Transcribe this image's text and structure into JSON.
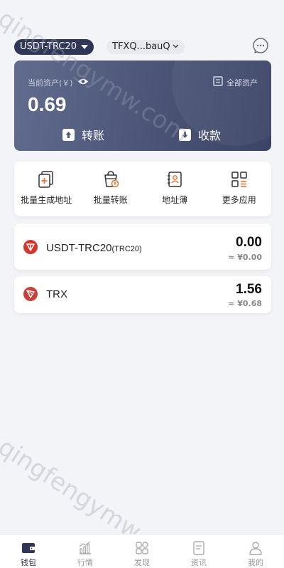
{
  "header": {
    "chain_label": "USDT-TRC20",
    "address_label": "TFXQ...bauQ"
  },
  "asset_card": {
    "asset_label": "当前资产(￥)",
    "all_assets_label": "全部资产",
    "balance": "0.69",
    "transfer_label": "转账",
    "receive_label": "收款"
  },
  "quick_actions": [
    {
      "label": "批量生成地址",
      "icon": "batch-address-icon"
    },
    {
      "label": "批量转账",
      "icon": "batch-transfer-icon"
    },
    {
      "label": "地址薄",
      "icon": "address-book-icon"
    },
    {
      "label": "更多应用",
      "icon": "more-apps-icon"
    }
  ],
  "tokens": [
    {
      "name": "USDT-TRC20",
      "suffix": "(TRC20)",
      "amount": "0.00",
      "fiat": "≈ ¥0.00",
      "icon": "tron-token-icon"
    },
    {
      "name": "TRX",
      "suffix": "",
      "amount": "1.56",
      "fiat": "≈ ¥0.68",
      "icon": "trx-icon"
    }
  ],
  "watermark": "qingfengymw.com",
  "tabbar": [
    {
      "label": "钱包",
      "icon": "wallet-icon",
      "active": true
    },
    {
      "label": "行情",
      "icon": "chart-icon",
      "active": false
    },
    {
      "label": "发现",
      "icon": "discover-icon",
      "active": false
    },
    {
      "label": "资讯",
      "icon": "news-icon",
      "active": false
    },
    {
      "label": "我的",
      "icon": "profile-icon",
      "active": false
    }
  ],
  "colors": {
    "primary_dark": "#2f3657",
    "card_gradient_start": "#616c8e",
    "card_gradient_end": "#3b4366",
    "accent_orange": "#e8763a",
    "tron_red": "#d6342c"
  }
}
